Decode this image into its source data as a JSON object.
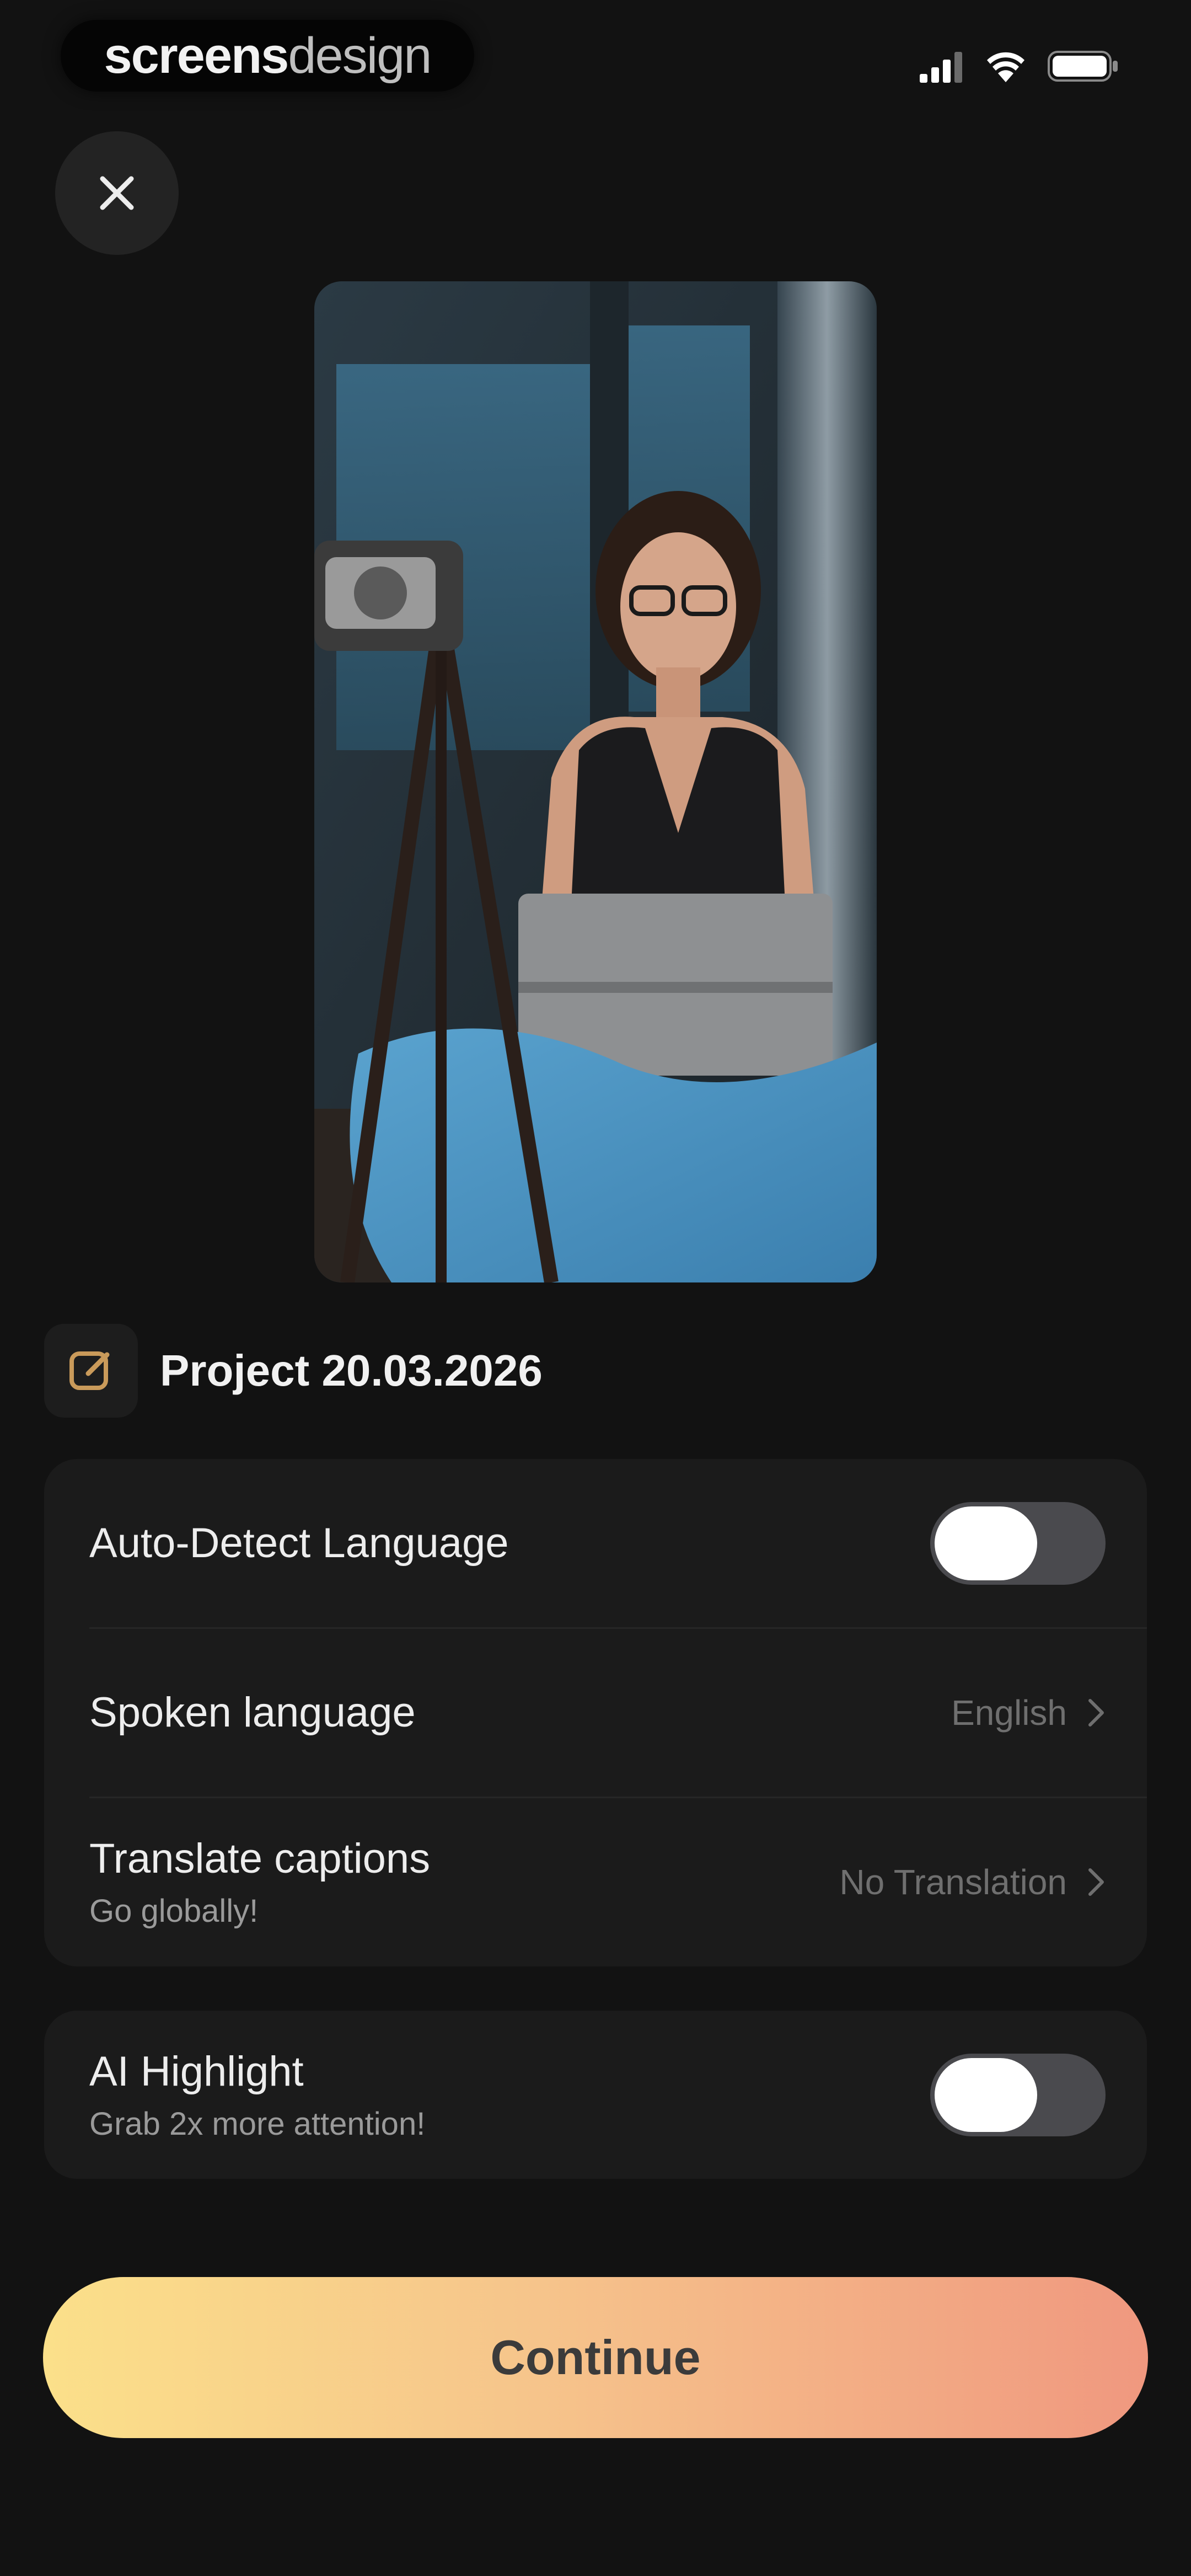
{
  "status_bar": {
    "brand_bold": "screens",
    "brand_light": "design",
    "icons": [
      "signal-icon",
      "wifi-icon",
      "battery-icon"
    ]
  },
  "header": {
    "close_icon": "close-icon"
  },
  "preview": {
    "icon": "video-preview-image"
  },
  "project": {
    "icon": "edit-icon",
    "title": "Project 20.03.2026"
  },
  "settings": {
    "auto_detect": {
      "label": "Auto-Detect Language",
      "enabled": true
    },
    "spoken_language": {
      "label": "Spoken language",
      "value": "English"
    },
    "translate": {
      "label": "Translate captions",
      "subtitle": "Go globally!",
      "value": "No Translation"
    }
  },
  "ai_highlight": {
    "label": "AI Highlight",
    "subtitle": "Grab 2x more attention!",
    "enabled": true
  },
  "continue": {
    "label": "Continue"
  },
  "colors": {
    "background": "#121212",
    "card": "#1b1b1b",
    "accent_start": "#fbe08a",
    "accent_end": "#f0987f",
    "project_icon": "#c99a5a"
  }
}
